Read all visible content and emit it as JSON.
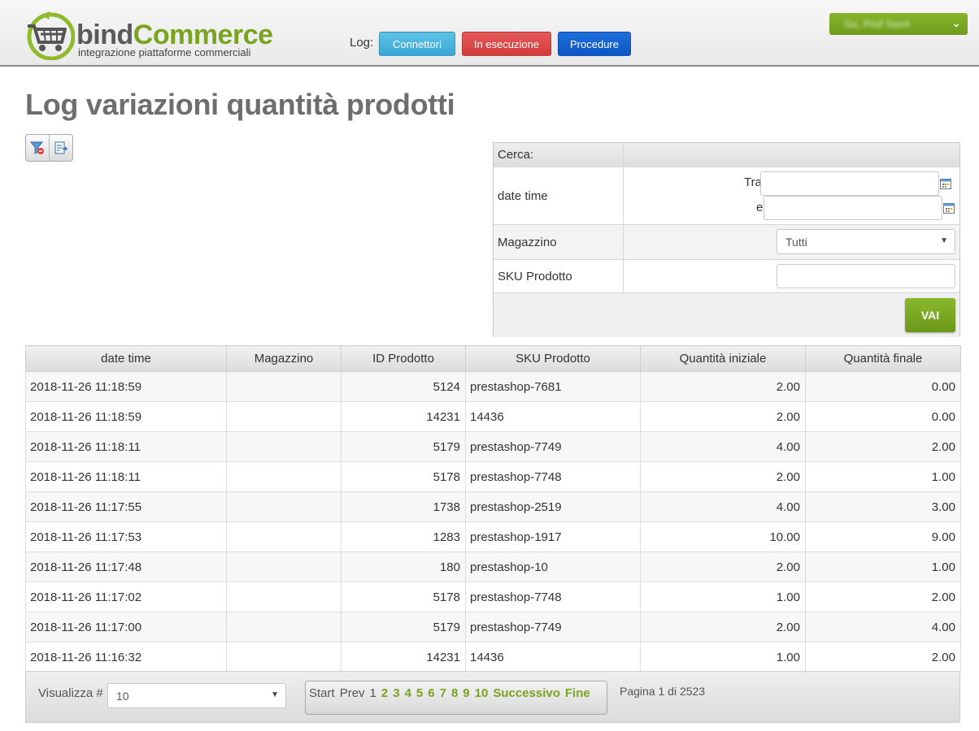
{
  "brand": {
    "word1": "bind",
    "word2": "Commerce",
    "tagline": "integrazione piattaforme commerciali"
  },
  "nav": {
    "log_label": "Log:",
    "buttons": [
      "Connettori",
      "In esecuzione",
      "Procedure"
    ],
    "colors": {
      "connettori": "#38a8d6",
      "in_esecuzione": "#d43a3a",
      "procedure": "#0b55c4"
    }
  },
  "user_menu": {
    "name": "Gx, Prof Savrl"
  },
  "page": {
    "title": "Log variazioni quantità prodotti"
  },
  "toolbar": {
    "icons": [
      "clear-filter-icon",
      "export-icon"
    ]
  },
  "search": {
    "header": "Cerca:",
    "date_label": "date time",
    "between_label": "Tra",
    "and_label": "e",
    "from_value": "",
    "to_value": "",
    "warehouse_label": "Magazzino",
    "warehouse_selected": "Tutti",
    "sku_label": "SKU Prodotto",
    "sku_value": "",
    "submit_label": "VAI"
  },
  "table": {
    "columns": [
      "date time",
      "Magazzino",
      "ID Prodotto",
      "SKU Prodotto",
      "Quantità iniziale",
      "Quantità finale"
    ],
    "rows": [
      [
        "2018-11-26 11:18:59",
        "",
        "5124",
        "prestashop-7681",
        "2.00",
        "0.00"
      ],
      [
        "2018-11-26 11:18:59",
        "",
        "14231",
        "14436",
        "2.00",
        "0.00"
      ],
      [
        "2018-11-26 11:18:11",
        "",
        "5179",
        "prestashop-7749",
        "4.00",
        "2.00"
      ],
      [
        "2018-11-26 11:18:11",
        "",
        "5178",
        "prestashop-7748",
        "2.00",
        "1.00"
      ],
      [
        "2018-11-26 11:17:55",
        "",
        "1738",
        "prestashop-2519",
        "4.00",
        "3.00"
      ],
      [
        "2018-11-26 11:17:53",
        "",
        "1283",
        "prestashop-1917",
        "10.00",
        "9.00"
      ],
      [
        "2018-11-26 11:17:48",
        "",
        "180",
        "prestashop-10",
        "2.00",
        "1.00"
      ],
      [
        "2018-11-26 11:17:02",
        "",
        "5178",
        "prestashop-7748",
        "1.00",
        "2.00"
      ],
      [
        "2018-11-26 11:17:00",
        "",
        "5179",
        "prestashop-7749",
        "2.00",
        "4.00"
      ],
      [
        "2018-11-26 11:16:32",
        "",
        "14231",
        "14436",
        "1.00",
        "2.00"
      ]
    ]
  },
  "footer": {
    "show_label": "Visualizza #",
    "page_size": "10",
    "pager": {
      "start": "Start",
      "prev": "Prev",
      "current": "1",
      "pages": [
        "2",
        "3",
        "4",
        "5",
        "6",
        "7",
        "8",
        "9",
        "10"
      ],
      "next": "Successivo",
      "end": "Fine"
    },
    "page_info": "Pagina 1 di 2523"
  }
}
